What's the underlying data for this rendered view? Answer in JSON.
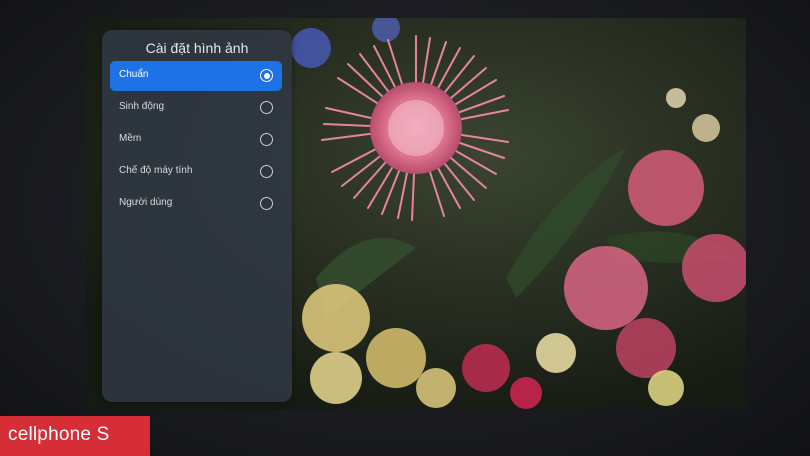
{
  "picture_settings": {
    "title": "Cài đặt hình ảnh",
    "options": [
      {
        "label": "Chuẩn",
        "selected": true
      },
      {
        "label": "Sinh động",
        "selected": false
      },
      {
        "label": "Mềm",
        "selected": false
      },
      {
        "label": "Chế độ máy tính",
        "selected": false
      },
      {
        "label": "Người dùng",
        "selected": false
      }
    ]
  },
  "watermark": {
    "text": "cellphone S"
  },
  "colors": {
    "accent": "#1d73e6",
    "panel": "#303844",
    "brand": "#d62e36"
  }
}
